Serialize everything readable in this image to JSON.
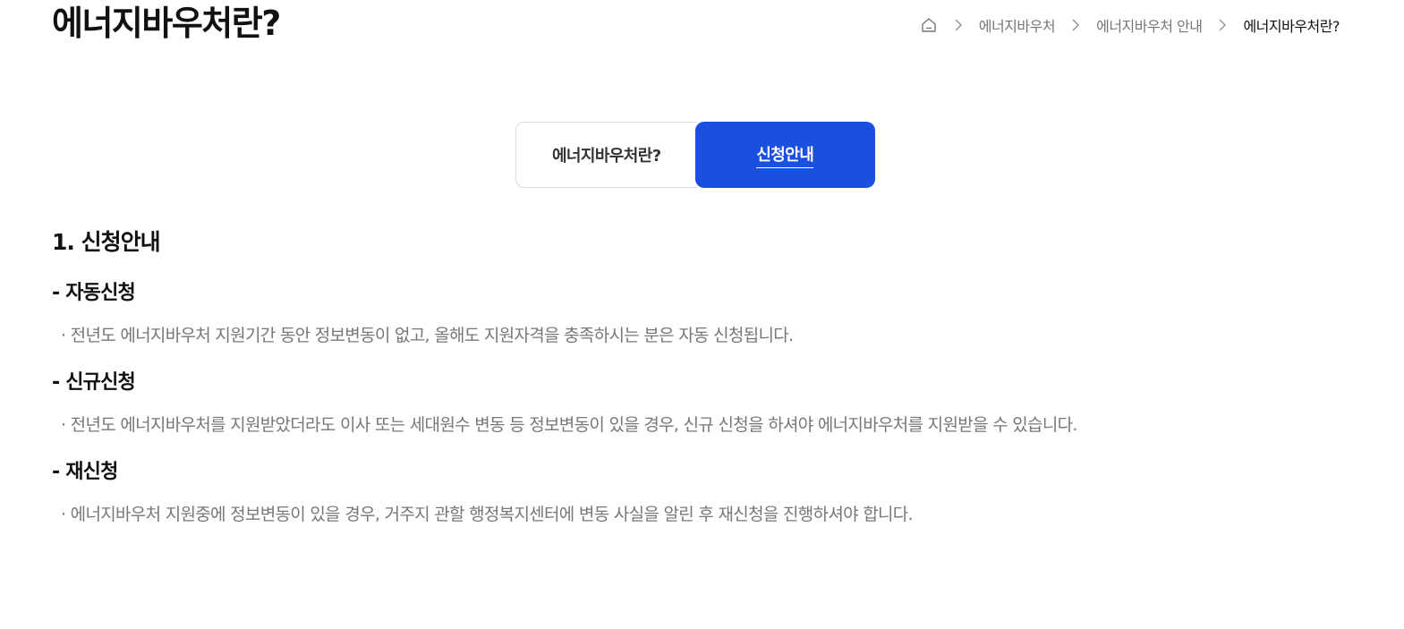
{
  "page": {
    "title": "에너지바우처란?"
  },
  "breadcrumb": {
    "home_icon": "home-icon",
    "separator_icon": "chevron-right-icon",
    "items": [
      "에너지바우처",
      "에너지바우처 안내",
      "에너지바우처란?"
    ]
  },
  "tabs": [
    {
      "label": "에너지바우처란?",
      "active": false
    },
    {
      "label": "신청안내",
      "active": true
    }
  ],
  "colors": {
    "accent": "#1a4fe0",
    "text_dark": "#111111",
    "text_muted": "#777777"
  },
  "content": {
    "section_title": "1. 신청안내",
    "blocks": [
      {
        "title": "- 자동신청",
        "text": "· 전년도 에너지바우처 지원기간 동안 정보변동이 없고, 올해도 지원자격을 충족하시는 분은 자동 신청됩니다."
      },
      {
        "title": "- 신규신청",
        "text": "· 전년도 에너지바우처를 지원받았더라도 이사 또는 세대원수 변동 등 정보변동이 있을 경우, 신규 신청을 하셔야 에너지바우처를 지원받을 수 있습니다."
      },
      {
        "title": "- 재신청",
        "text": "· 에너지바우처 지원중에 정보변동이 있을 경우, 거주지 관할 행정복지센터에 변동 사실을 알린 후 재신청을 진행하셔야 합니다."
      }
    ]
  }
}
